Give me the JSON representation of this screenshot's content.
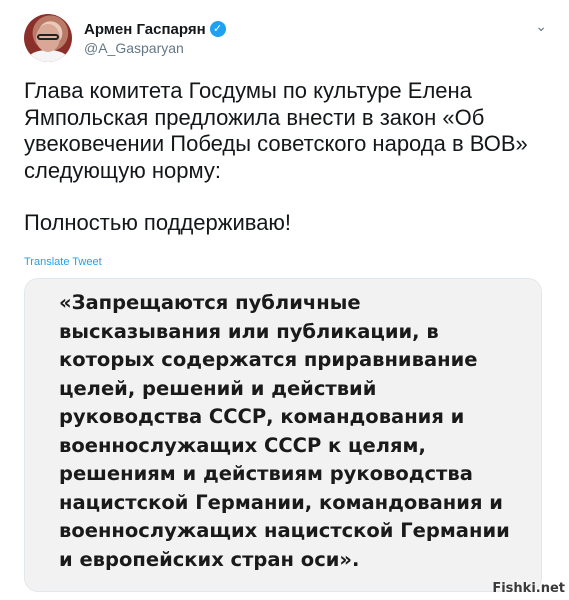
{
  "author": {
    "display_name": "Армен Гаспарян",
    "handle": "@A_Gasparyan",
    "verified_icon": "verified-badge-icon"
  },
  "tweet": {
    "paragraphs": [
      "Глава комитета Госдумы по культуре Елена Ямпольская предложила внести в закон «Об увековечении Победы советского народа в ВОВ» следующую норму:",
      "Полностью поддерживаю!"
    ],
    "translate_label": "Translate Tweet"
  },
  "media": {
    "quote": "«Запрещаются публичные высказывания или публикации, в которых содержатся приравнивание целей, решений и действий руководства СССР, командования и военнослужащих СССР к целям, решениям и действиям руководства нацистской Германии, командования и военнослужащих нацистской Германии и европейских стран оси»."
  },
  "watermark": "Fishki.net",
  "colors": {
    "link": "#1da1f2",
    "text": "#14171a",
    "muted": "#657786",
    "media_bg": "#f2f2f2"
  }
}
